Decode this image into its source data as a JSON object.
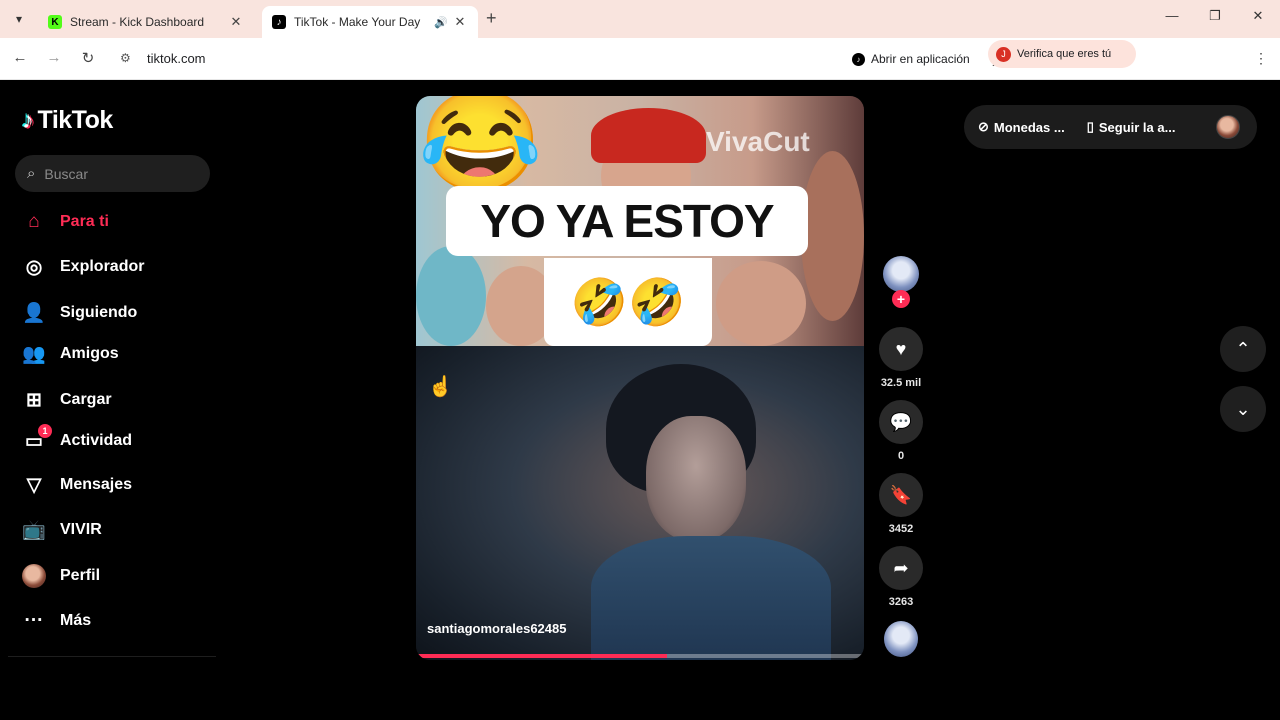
{
  "browser": {
    "tabs": [
      {
        "title": "Stream - Kick Dashboard",
        "favicon": "kick-logo"
      },
      {
        "title": "TikTok - Make Your Day",
        "favicon": "tiktok-logo",
        "active": true
      }
    ],
    "url": "tiktok.com",
    "open_in_app_label": "Abrir en aplicación",
    "verify_label": "Verifica que eres tú"
  },
  "sidebar": {
    "logo_text": "TikTok",
    "search_placeholder": "Buscar",
    "items": [
      {
        "label": "Para ti",
        "icon": "home-icon",
        "active": true
      },
      {
        "label": "Explorador",
        "icon": "compass-icon"
      },
      {
        "label": "Siguiendo",
        "icon": "user-follow-icon"
      },
      {
        "label": "Amigos",
        "icon": "friends-icon"
      },
      {
        "label": "Cargar",
        "icon": "upload-icon"
      },
      {
        "label": "Actividad",
        "icon": "activity-icon",
        "badge": "1"
      },
      {
        "label": "Mensajes",
        "icon": "send-icon"
      },
      {
        "label": "VIVIR",
        "icon": "live-tv-icon"
      },
      {
        "label": "Perfil",
        "icon": "avatar"
      },
      {
        "label": "Más",
        "icon": "more-icon"
      }
    ]
  },
  "video": {
    "caption_overlay": "YO YA ESTOY",
    "caption_emoji": "🤣🤣",
    "watermark": "VivaCut",
    "author": "santiagomorales62485",
    "progress": 0.56
  },
  "actions": {
    "likes": "32.5 mil",
    "comments": "0",
    "saves": "3452",
    "shares": "3263"
  },
  "topright": {
    "coins_label": "Monedas ...",
    "follow_app_label": "Seguir la a..."
  },
  "colors": {
    "accent": "#fe2c55",
    "tab_bar": "#f9e4de",
    "page_bg": "#000000"
  }
}
